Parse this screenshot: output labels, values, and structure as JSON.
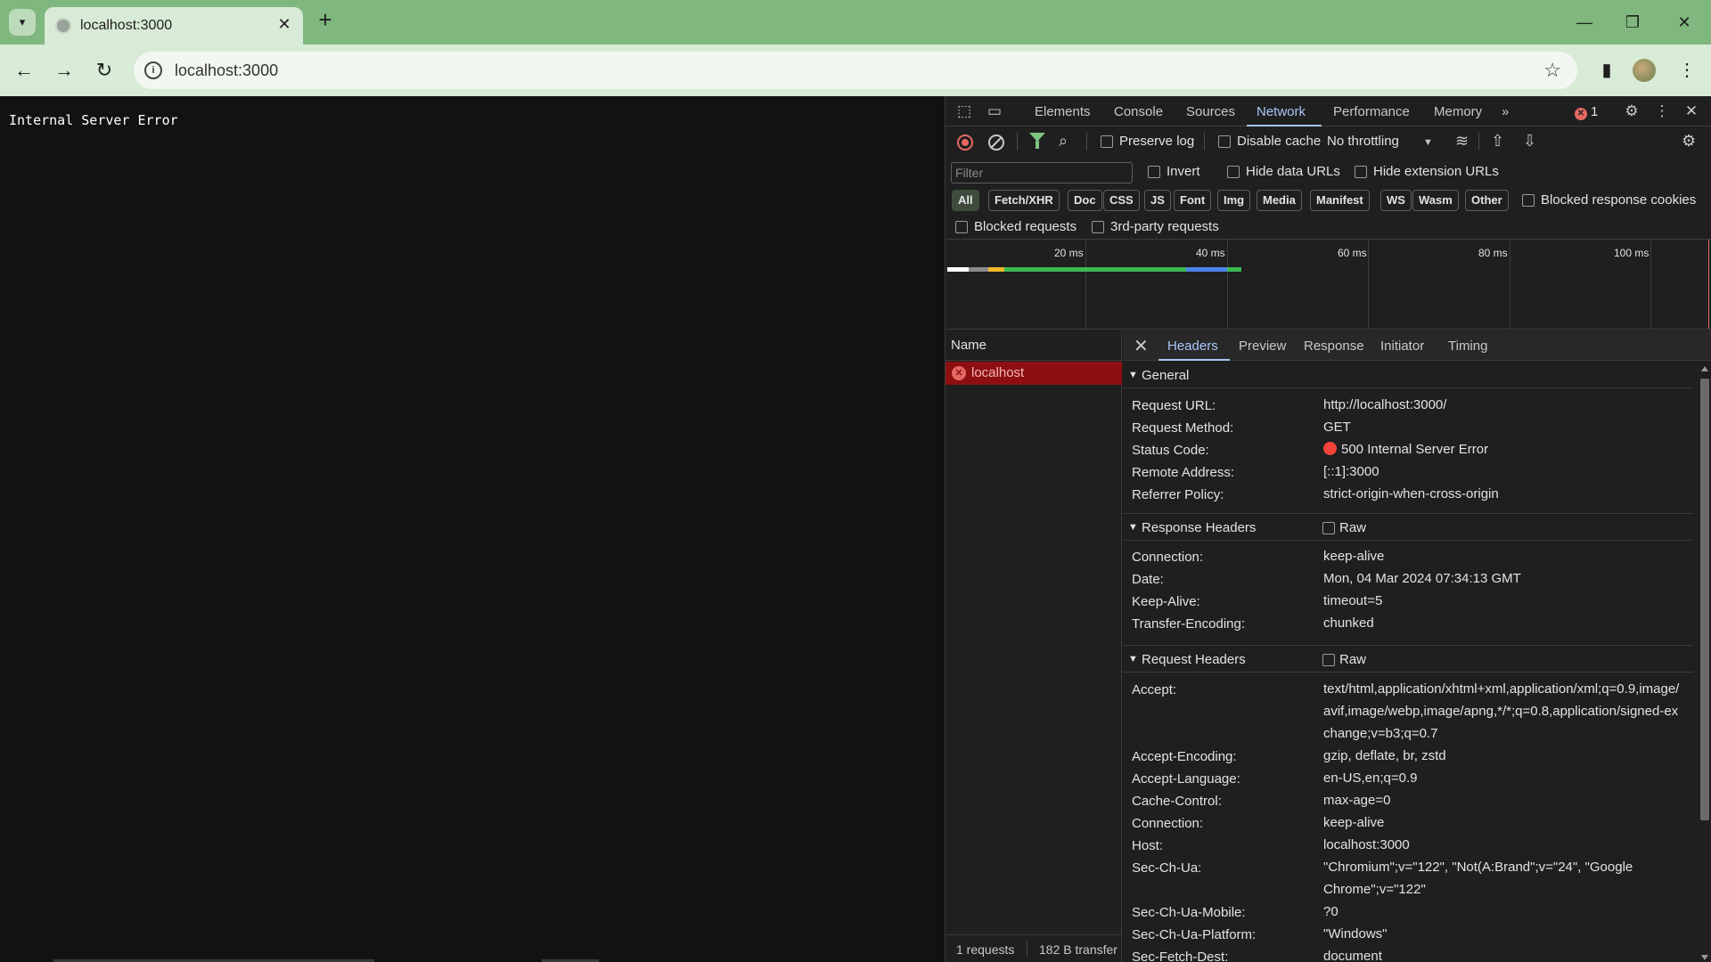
{
  "browser": {
    "tab_title": "localhost:3000",
    "address": "localhost:3000"
  },
  "page": {
    "message": "Internal Server Error"
  },
  "devtools": {
    "panel_tabs": [
      "Elements",
      "Console",
      "Sources",
      "Network",
      "Performance",
      "Memory"
    ],
    "active_tab": "Network",
    "error_count": "1",
    "toolbar": {
      "preserve_log": "Preserve log",
      "disable_cache": "Disable cache",
      "throttling": "No throttling"
    },
    "filter": {
      "placeholder": "Filter",
      "invert": "Invert",
      "hide_data_urls": "Hide data URLs",
      "hide_extension_urls": "Hide extension URLs",
      "types": [
        "All",
        "Fetch/XHR",
        "Doc",
        "CSS",
        "JS",
        "Font",
        "Img",
        "Media",
        "Manifest",
        "WS",
        "Wasm",
        "Other"
      ],
      "blocked_response_cookies": "Blocked response cookies",
      "blocked_requests": "Blocked requests",
      "third_party": "3rd-party requests"
    },
    "overview": {
      "ticks": [
        "20 ms",
        "40 ms",
        "60 ms",
        "80 ms",
        "100 ms"
      ]
    },
    "requests": {
      "name_header": "Name",
      "rows": [
        {
          "name": "localhost",
          "status": "error"
        }
      ],
      "summary_count": "1 requests",
      "summary_transfer": "182 B transfer"
    },
    "details": {
      "tabs": [
        "Headers",
        "Preview",
        "Response",
        "Initiator",
        "Timing"
      ],
      "active_tab": "Headers",
      "raw_label": "Raw",
      "general": {
        "title": "General",
        "request_url_k": "Request URL:",
        "request_url": "http://localhost:3000/",
        "request_method_k": "Request Method:",
        "request_method": "GET",
        "status_code_k": "Status Code:",
        "status_code": "500 Internal Server Error",
        "remote_address_k": "Remote Address:",
        "remote_address": "[::1]:3000",
        "referrer_policy_k": "Referrer Policy:",
        "referrer_policy": "strict-origin-when-cross-origin"
      },
      "response_headers": {
        "title": "Response Headers",
        "connection_k": "Connection:",
        "connection": "keep-alive",
        "date_k": "Date:",
        "date": "Mon, 04 Mar 2024 07:34:13 GMT",
        "keep_alive_k": "Keep-Alive:",
        "keep_alive": "timeout=5",
        "transfer_encoding_k": "Transfer-Encoding:",
        "transfer_encoding": "chunked"
      },
      "request_headers": {
        "title": "Request Headers",
        "accept_k": "Accept:",
        "accept": "text/html,application/xhtml+xml,application/xml;q=0.9,image/avif,image/webp,image/apng,*/*;q=0.8,application/signed-exchange;v=b3;q=0.7",
        "accept_encoding_k": "Accept-Encoding:",
        "accept_encoding": "gzip, deflate, br, zstd",
        "accept_language_k": "Accept-Language:",
        "accept_language": "en-US,en;q=0.9",
        "cache_control_k": "Cache-Control:",
        "cache_control": "max-age=0",
        "connection_k": "Connection:",
        "connection": "keep-alive",
        "host_k": "Host:",
        "host": "localhost:3000",
        "sec_ch_ua_k": "Sec-Ch-Ua:",
        "sec_ch_ua": "\"Chromium\";v=\"122\", \"Not(A:Brand\";v=\"24\", \"Google Chrome\";v=\"122\"",
        "sec_ch_ua_mobile_k": "Sec-Ch-Ua-Mobile:",
        "sec_ch_ua_mobile": "?0",
        "sec_ch_ua_platform_k": "Sec-Ch-Ua-Platform:",
        "sec_ch_ua_platform": "\"Windows\"",
        "sec_fetch_dest_k": "Sec-Fetch-Dest:",
        "sec_fetch_dest": "document"
      }
    }
  },
  "colors": {
    "chrome_frame": "#7fb77e",
    "toolbar": "#d8ebd6",
    "page_bg": "#121212",
    "devtools_bg": "#1f1f1f",
    "accent": "#a8c7fa",
    "error": "#e46962",
    "error_row": "#8e0f12"
  }
}
